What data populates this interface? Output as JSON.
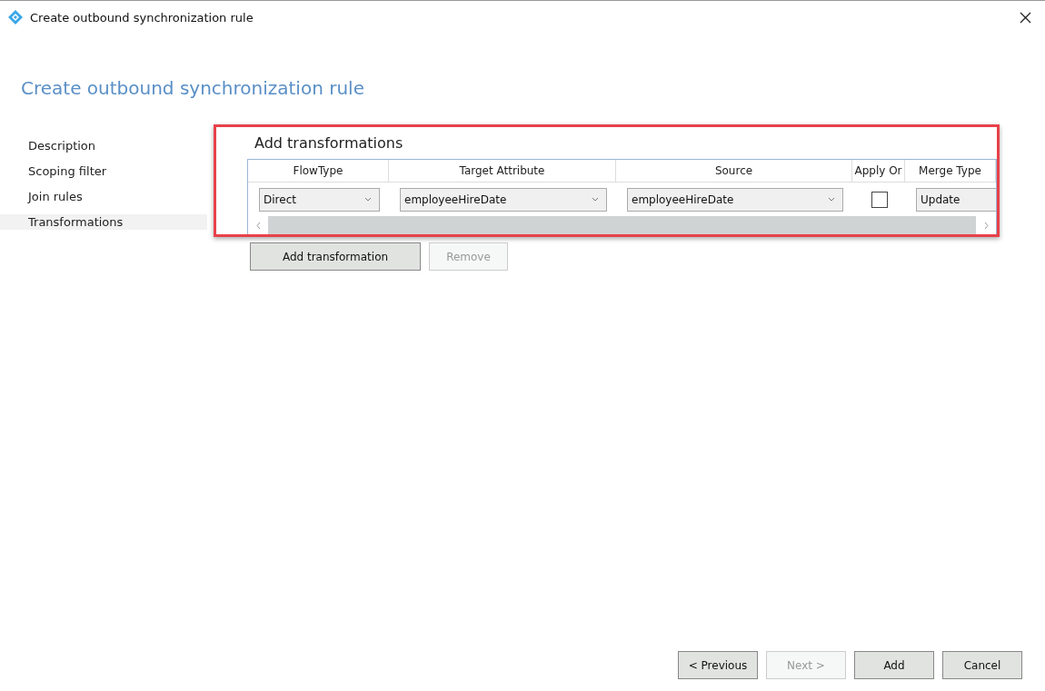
{
  "window": {
    "title": "Create outbound synchronization rule"
  },
  "heading": "Create outbound synchronization rule",
  "nav": [
    {
      "label": "Description",
      "selected": false
    },
    {
      "label": "Scoping filter",
      "selected": false
    },
    {
      "label": "Join rules",
      "selected": false
    },
    {
      "label": "Transformations",
      "selected": true
    }
  ],
  "section_title": "Add transformations",
  "table": {
    "columns": [
      "FlowType",
      "Target Attribute",
      "Source",
      "Apply Or",
      "Merge Type"
    ],
    "rows": [
      [
        {
          "kind": "dropdown",
          "value": "Direct"
        },
        {
          "kind": "dropdown",
          "value": "employeeHireDate"
        },
        {
          "kind": "dropdown",
          "value": "employeeHireDate"
        },
        {
          "kind": "checkbox",
          "checked": false
        },
        {
          "kind": "text",
          "value": "Update"
        }
      ]
    ]
  },
  "table_buttons": [
    {
      "label": "Add transformation",
      "disabled": false
    },
    {
      "label": "Remove",
      "disabled": true
    }
  ],
  "footer_buttons": [
    {
      "label": "< Previous",
      "disabled": false
    },
    {
      "label": "Next >",
      "disabled": true
    },
    {
      "label": "Add",
      "disabled": false
    },
    {
      "label": "Cancel",
      "disabled": false
    }
  ]
}
